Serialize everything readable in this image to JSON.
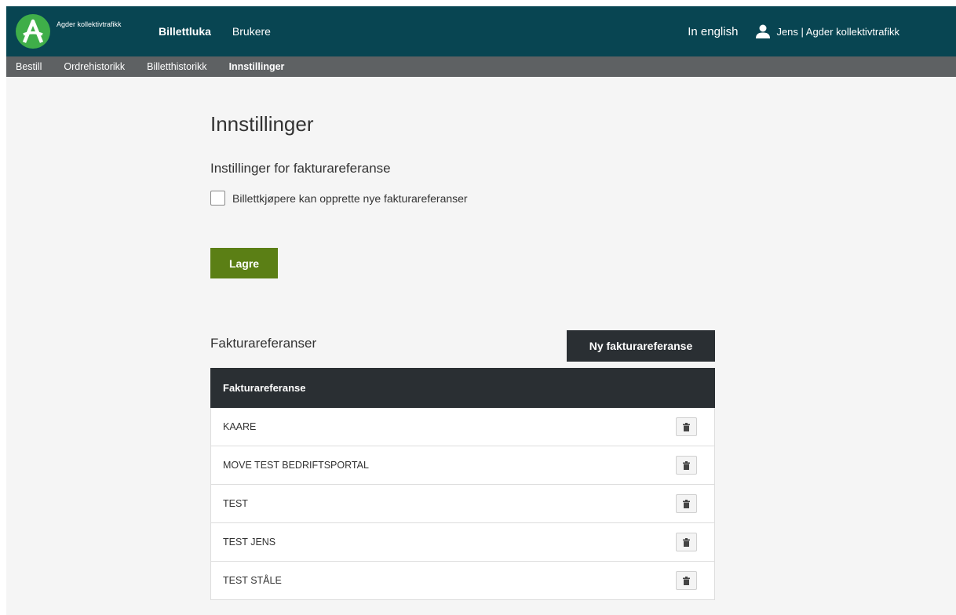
{
  "brand": {
    "name": "Agder kollektivtrafikk",
    "logo_icon": "agder-a-logo",
    "primary_color": "#084552",
    "logo_color": "#3fae49"
  },
  "topnav": {
    "items": [
      {
        "label": "Billettluka",
        "active": true
      },
      {
        "label": "Brukere",
        "active": false
      }
    ],
    "language_link": "In english",
    "user_icon": "user-icon",
    "user_label": "Jens | Agder kollektivtrafikk"
  },
  "subnav": {
    "items": [
      {
        "label": "Bestill",
        "active": false
      },
      {
        "label": "Ordrehistorikk",
        "active": false
      },
      {
        "label": "Billetthistorikk",
        "active": false
      },
      {
        "label": "Innstillinger",
        "active": true
      }
    ]
  },
  "settings": {
    "title": "Innstillinger",
    "invoice_settings_title": "Instillinger for fakturareferanse",
    "checkbox_label": "Billettkjøpere kan opprette nye fakturareferanser",
    "checkbox_checked": false,
    "save_label": "Lagre",
    "save_color": "#5b7f15"
  },
  "references": {
    "title": "Fakturareferanser",
    "new_button_label": "Ny fakturareferanse",
    "column_header": "Fakturareferanse",
    "delete_icon": "trash-icon",
    "rows": [
      {
        "name": "KAARE"
      },
      {
        "name": "MOVE TEST BEDRIFTSPORTAL"
      },
      {
        "name": "TEST"
      },
      {
        "name": "TEST JENS"
      },
      {
        "name": "TEST STÅLE"
      }
    ]
  }
}
